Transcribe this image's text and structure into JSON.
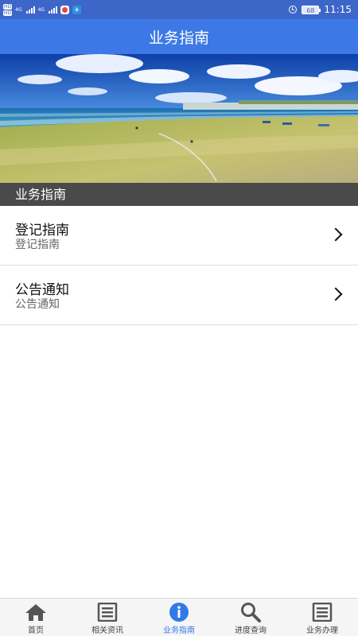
{
  "status_bar": {
    "hd1": "HD",
    "hd2": "HD",
    "net1": "4G",
    "net2": "4G",
    "battery": "68",
    "time": "11:15"
  },
  "header": {
    "title": "业务指南"
  },
  "banner": {
    "image": "beach-photo"
  },
  "section": {
    "title": "业务指南"
  },
  "list": {
    "items": [
      {
        "title": "登记指南",
        "subtitle": "登记指南"
      },
      {
        "title": "公告通知",
        "subtitle": "公告通知"
      }
    ]
  },
  "tabbar": {
    "active_index": 2,
    "active_color": "#2f7ae6",
    "items": [
      {
        "label": "首页",
        "icon": "home-icon"
      },
      {
        "label": "相关资讯",
        "icon": "news-icon"
      },
      {
        "label": "业务指南",
        "icon": "info-icon"
      },
      {
        "label": "进度查询",
        "icon": "search-icon"
      },
      {
        "label": "业务办理",
        "icon": "document-icon"
      }
    ]
  },
  "colors": {
    "status_bar": "#3d66c9",
    "title_bar": "#3d79e6",
    "section_bar": "#4a4a4a"
  }
}
